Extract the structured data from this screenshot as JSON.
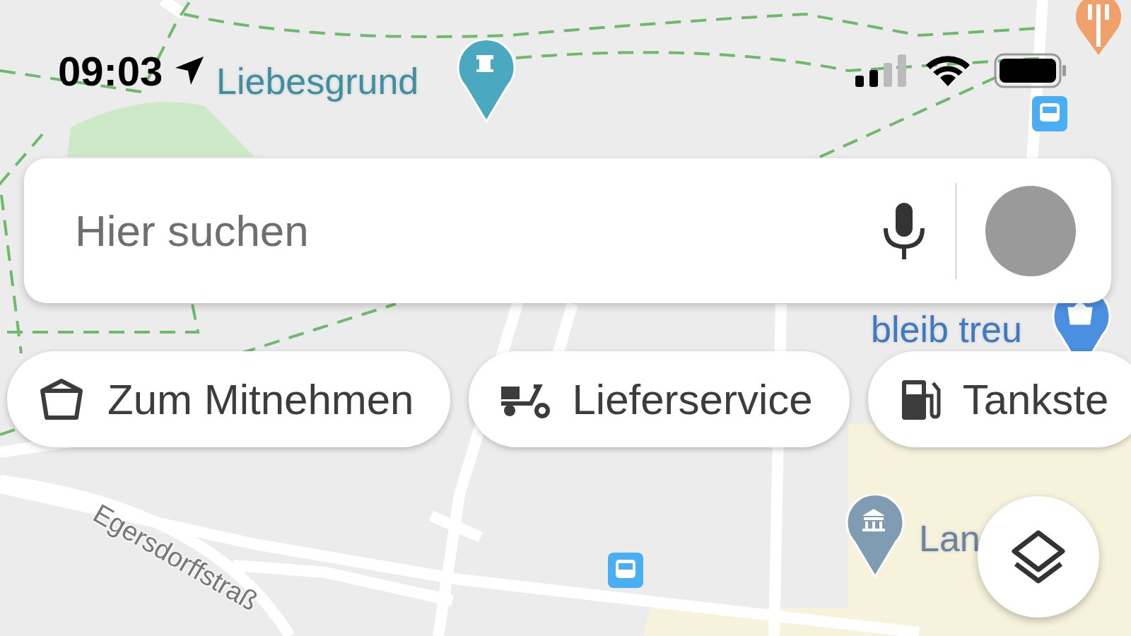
{
  "status_bar": {
    "time": "09:03"
  },
  "search": {
    "placeholder": "Hier suchen"
  },
  "chips": [
    {
      "label": "Zum Mitnehmen",
      "kind": "takeaway"
    },
    {
      "label": "Lieferservice",
      "kind": "delivery"
    },
    {
      "label": "Tankste",
      "kind": "fuel"
    }
  ],
  "map_labels": [
    {
      "text": "Liebesgrund",
      "kind": "castle",
      "color": "#4aa8bf"
    },
    {
      "text": "bleib treu",
      "kind": "shop",
      "color": "#4a8fe0"
    },
    {
      "text": "Lan",
      "kind": "building",
      "color": "#7f9cb3"
    },
    {
      "text": "Egersdorffstraß",
      "kind": "street"
    }
  ]
}
